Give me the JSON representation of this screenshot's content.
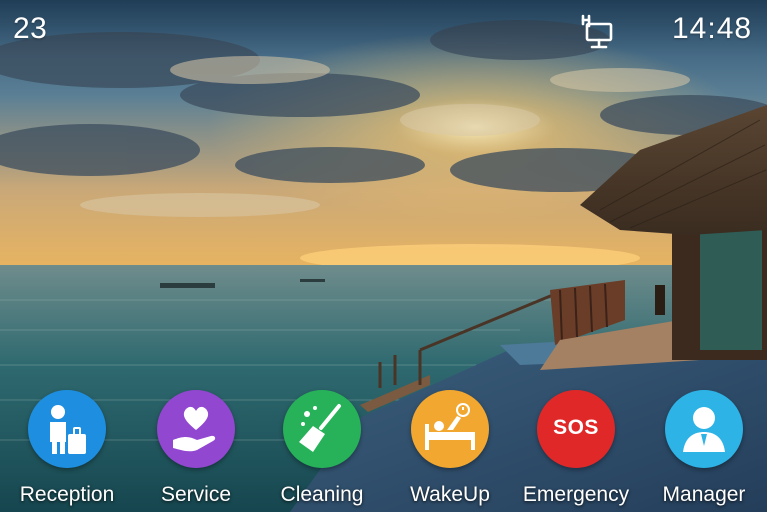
{
  "status_bar": {
    "account": "23",
    "time": "14:48",
    "network_icon": "ethernet-icon"
  },
  "apps": [
    {
      "id": "reception",
      "label": "Reception",
      "icon": "reception-icon",
      "color": "#1E8FE0"
    },
    {
      "id": "service",
      "label": "Service",
      "icon": "heart-hand-icon",
      "color": "#9247D0"
    },
    {
      "id": "cleaning",
      "label": "Cleaning",
      "icon": "broom-icon",
      "color": "#27B25A"
    },
    {
      "id": "wakeup",
      "label": "WakeUp",
      "icon": "wakeup-bed-icon",
      "color": "#F2A830"
    },
    {
      "id": "emergency",
      "label": "Emergency",
      "icon": "sos-icon",
      "color": "#E12828",
      "icon_text": "SOS"
    },
    {
      "id": "manager",
      "label": "Manager",
      "icon": "person-icon",
      "color": "#2DB3E6"
    }
  ]
}
